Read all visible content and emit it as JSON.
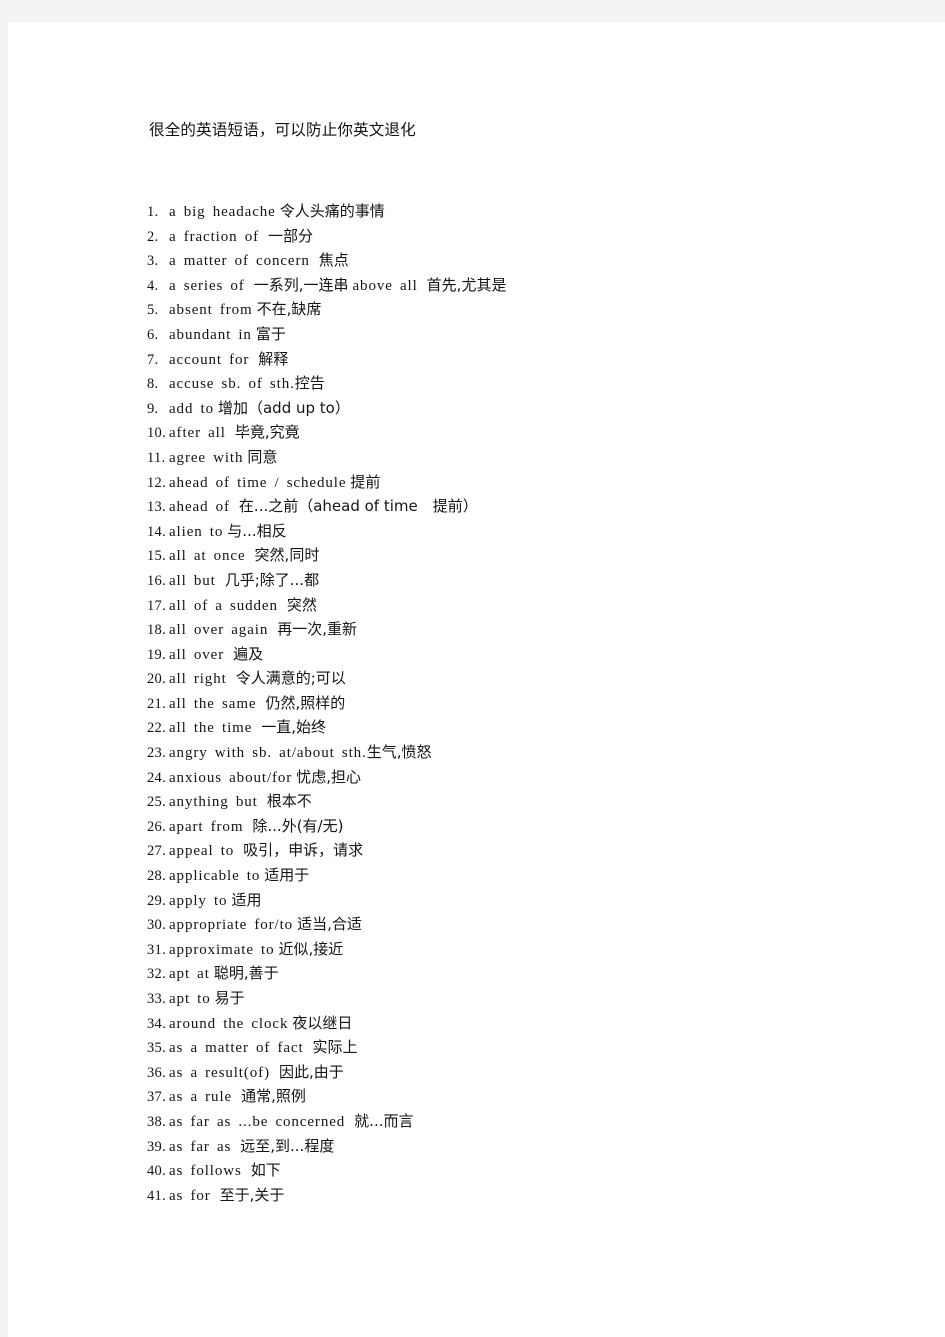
{
  "document": {
    "title": "很全的英语短语，可以防止你英文退化",
    "page_background": "#ffffff",
    "margin_background": "#f3f3f4",
    "text_color": "#141414"
  },
  "phrases": [
    {
      "num": "1.",
      "en": "a big headache",
      "gap": "s",
      "cn": "令人头痛的事情"
    },
    {
      "num": "2.",
      "en": "a fraction of",
      "gap": "m",
      "cn": "一部分"
    },
    {
      "num": "3.",
      "en": "a matter of concern",
      "gap": "m",
      "cn": "焦点"
    },
    {
      "num": "4.",
      "en": "a series of",
      "gap": "m",
      "cn": "一系列,一连串",
      "en2": "above all",
      "gap2": "m",
      "cn2": "首先,尤其是"
    },
    {
      "num": "5.",
      "en": "absent from",
      "gap": "s",
      "cn": "不在,缺席"
    },
    {
      "num": "6.",
      "en": "abundant in",
      "gap": "s",
      "cn": "富于"
    },
    {
      "num": "7.",
      "en": "account for",
      "gap": "m",
      "cn": "解释"
    },
    {
      "num": "8.",
      "en": "accuse sb. of sth.",
      "gap": "n",
      "cn": "控告"
    },
    {
      "num": "9.",
      "en": "add to",
      "gap": "s",
      "cn": "增加（add up to）"
    },
    {
      "num": "10.",
      "en": "after all",
      "gap": "m",
      "cn": "毕竟,究竟"
    },
    {
      "num": "11.",
      "en": "agree with",
      "gap": "s",
      "cn": "同意"
    },
    {
      "num": "12.",
      "en": "ahead of time / schedule",
      "gap": "s",
      "cn": "提前"
    },
    {
      "num": "13.",
      "en": "ahead of",
      "gap": "m",
      "cn": "在...之前（ahead of time　提前）"
    },
    {
      "num": "14.",
      "en": "alien to",
      "gap": "s",
      "cn": "与...相反"
    },
    {
      "num": "15.",
      "en": "all at once",
      "gap": "m",
      "cn": "突然,同时"
    },
    {
      "num": "16.",
      "en": "all but",
      "gap": "m",
      "cn": "几乎;除了...都"
    },
    {
      "num": "17.",
      "en": "all of a sudden",
      "gap": "m",
      "cn": "突然"
    },
    {
      "num": "18.",
      "en": "all over again",
      "gap": "m",
      "cn": "再一次,重新"
    },
    {
      "num": "19.",
      "en": "all over",
      "gap": "m",
      "cn": "遍及"
    },
    {
      "num": "20.",
      "en": "all right",
      "gap": "m",
      "cn": "令人满意的;可以"
    },
    {
      "num": "21.",
      "en": "all the same",
      "gap": "m",
      "cn": "仍然,照样的"
    },
    {
      "num": "22.",
      "en": "all the time",
      "gap": "m",
      "cn": "一直,始终"
    },
    {
      "num": "23.",
      "en": "angry with sb. at/about sth.",
      "gap": "n",
      "cn": "生气,愤怒"
    },
    {
      "num": "24.",
      "en": "anxious about/for",
      "gap": "s",
      "cn": "忧虑,担心"
    },
    {
      "num": "25.",
      "en": "anything but",
      "gap": "m",
      "cn": "根本不"
    },
    {
      "num": "26.",
      "en": "apart from",
      "gap": "m",
      "cn": "除...外(有/无)"
    },
    {
      "num": "27.",
      "en": "appeal to",
      "gap": "m",
      "cn": "吸引，申诉，请求"
    },
    {
      "num": "28.",
      "en": "applicable to",
      "gap": "s",
      "cn": "适用于"
    },
    {
      "num": "29.",
      "en": "apply to",
      "gap": "s",
      "cn": "适用"
    },
    {
      "num": "30.",
      "en": "appropriate for/to",
      "gap": "s",
      "cn": "适当,合适"
    },
    {
      "num": "31.",
      "en": "approximate to",
      "gap": "s",
      "cn": "近似,接近"
    },
    {
      "num": "32.",
      "en": "apt at",
      "gap": "s",
      "cn": "聪明,善于"
    },
    {
      "num": "33.",
      "en": "apt to",
      "gap": "s",
      "cn": "易于"
    },
    {
      "num": "34.",
      "en": "around the clock",
      "gap": "s",
      "cn": "夜以继日"
    },
    {
      "num": "35.",
      "en": "as a matter of fact",
      "gap": "m",
      "cn": "实际上"
    },
    {
      "num": "36.",
      "en": "as a result(of)",
      "gap": "m",
      "cn": "因此,由于"
    },
    {
      "num": "37.",
      "en": "as a rule",
      "gap": "m",
      "cn": "通常,照例"
    },
    {
      "num": "38.",
      "en": "as far as ...be concerned",
      "gap": "m",
      "cn": "就...而言"
    },
    {
      "num": "39.",
      "en": "as far as",
      "gap": "m",
      "cn": "远至,到...程度"
    },
    {
      "num": "40.",
      "en": "as follows",
      "gap": "m",
      "cn": "如下"
    },
    {
      "num": "41.",
      "en": "as for",
      "gap": "m",
      "cn": "至于,关于"
    }
  ]
}
